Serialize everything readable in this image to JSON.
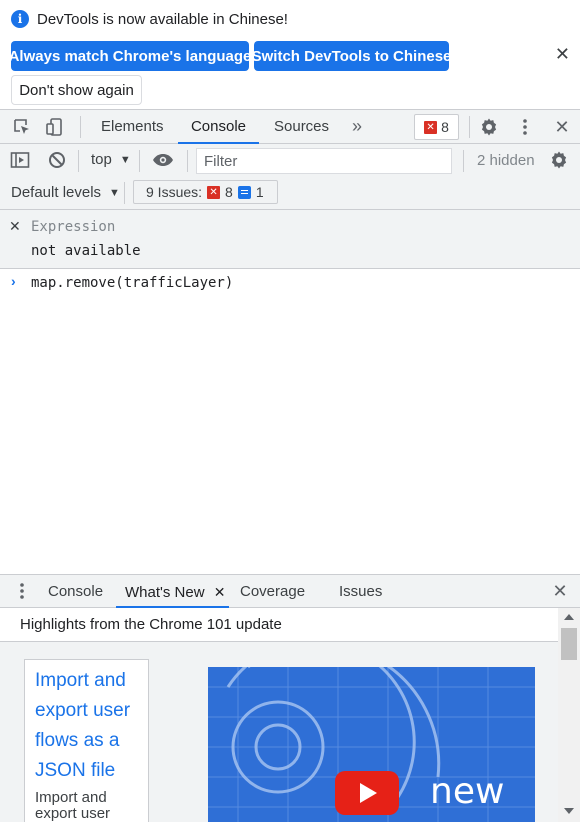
{
  "infobar": {
    "message": "DevTools is now available in Chinese!",
    "buttons": {
      "always_match": "Always match Chrome's language",
      "switch": "Switch DevTools to Chinese",
      "dont_show": "Don't show again"
    }
  },
  "main_tabs": [
    "Elements",
    "Console",
    "Sources"
  ],
  "main_tabs_active": "Console",
  "error_count": "8",
  "console_toolbar": {
    "context": "top",
    "filter_placeholder": "Filter",
    "hidden": "2 hidden",
    "levels": "Default levels",
    "issues_label": "9 Issues:",
    "issues_errors": "8",
    "issues_info": "1"
  },
  "live_expression": {
    "label": "Expression",
    "value": "not available"
  },
  "console_input": "map.remove(trafficLayer)",
  "drawer": {
    "tabs": [
      "Console",
      "What's New",
      "Coverage",
      "Issues"
    ],
    "active_tab": "What's New",
    "header": "Highlights from the Chrome 101 update",
    "card": {
      "link": "Import and export user flows as a JSON file",
      "description": "Import and export user flows as a JSON file"
    },
    "hero_text": "new"
  },
  "colors": {
    "accent": "#1a73e8",
    "error": "#d93025",
    "toolbar_bg": "#f1f3f4",
    "border": "#cbcdd1"
  }
}
